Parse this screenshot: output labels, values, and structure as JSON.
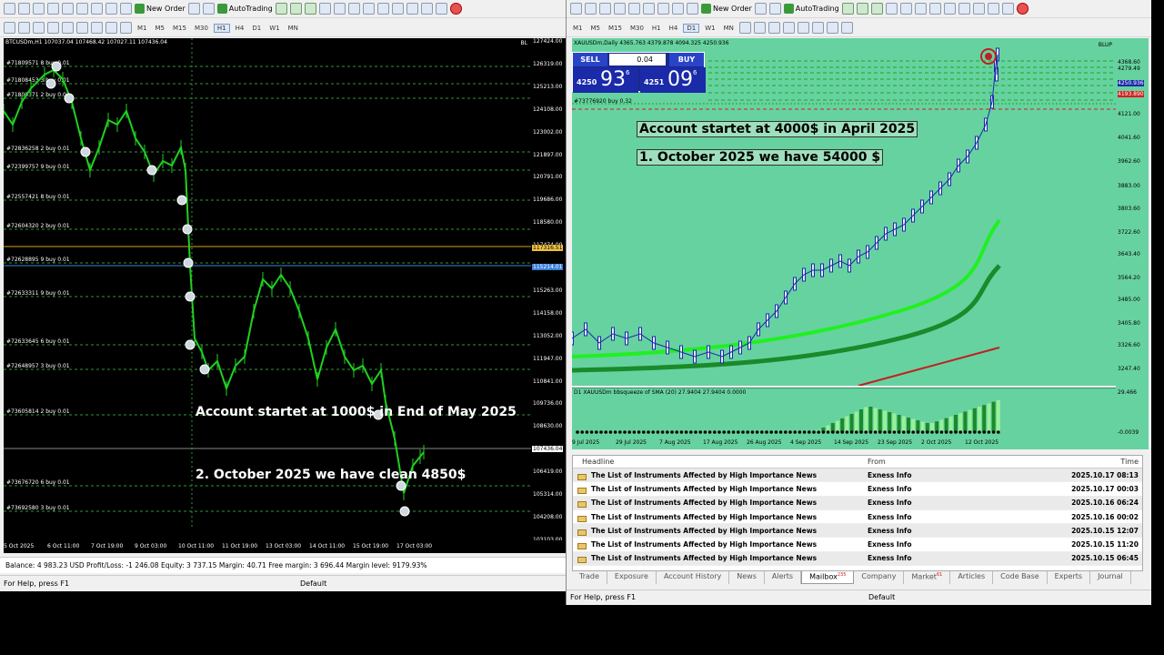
{
  "left": {
    "toolbar": {
      "new_order": "New Order",
      "autotrading": "AutoTrading",
      "timeframes": [
        "M1",
        "M5",
        "M15",
        "M30",
        "H1",
        "H4",
        "D1",
        "W1",
        "MN"
      ],
      "active_tf": "H1"
    },
    "chart_title": "BTCUSDm,H1  107037.04 107468.42 107027.11 107436.04",
    "corner_label": "BL",
    "price_labels": [
      "127424.00",
      "126319.00",
      "125213.00",
      "124108.00",
      "123002.00",
      "121897.00",
      "120791.00",
      "119686.00",
      "118580.00",
      "117474.00",
      "116369.00",
      "115263.00",
      "114158.00",
      "113052.00",
      "111947.00",
      "110841.00",
      "109736.00",
      "108630.00",
      "107525.00",
      "106419.00",
      "105314.00",
      "104208.00",
      "103103.00"
    ],
    "highlight_price_1": "117316.51",
    "highlight_price_2": "115214.01",
    "highlight_price_3": "107436.04",
    "order_labels": [
      "#71809571 8 buy 0.01",
      "#71808453 3 buy 0.01",
      "#71800371 2 buy 0.01",
      "#72836258 2 buy 0.01",
      "#72399757 9 buy 0.01",
      "#72557421 8 buy 0.01",
      "#72604320 2 buy 0.01",
      "#72628895 9 buy 0.01",
      "#72633311 9 buy 0.01",
      "#72633645 6 buy 0.01",
      "#72648957 3 buy 0.01",
      "#73605814 2 buy 0.01",
      "#73676720 6 buy 0.01",
      "#73692580 3 buy 0.01"
    ],
    "dates": [
      "5 Oct 2025",
      "6 Oct 11:00",
      "7 Oct 19:00",
      "9 Oct 03:00",
      "10 Oct 11:00",
      "11 Oct 19:00",
      "13 Oct 03:00",
      "14 Oct 11:00",
      "15 Oct 19:00",
      "17 Oct 03:00"
    ],
    "annotation_1": "Account startet at 1000$ in End of May 2025",
    "annotation_2": "2. October 2025 we have clean 4850$",
    "status": "Balance: 4 983.23 USD  Profit/Loss: -1 246.08  Equity: 3 737.15  Margin: 40.71  Free margin: 3 696.44  Margin level: 9179.93%",
    "help": "For Help, press F1",
    "profile": "Default"
  },
  "right": {
    "toolbar": {
      "new_order": "New Order",
      "autotrading": "AutoTrading",
      "timeframes": [
        "M1",
        "M5",
        "M15",
        "M30",
        "H1",
        "H4",
        "D1",
        "W1",
        "MN"
      ],
      "active_tf": "D1"
    },
    "chart_title": "XAUUSDm,Daily  4365.763 4379.878 4094.325 4250.936",
    "corner_label": "BLUP",
    "trade_panel": {
      "sell": "SELL",
      "buy": "BUY",
      "lot": "0.04",
      "sell_prefix": "4250",
      "sell_big": "93",
      "sell_sup": "6",
      "buy_prefix": "4251",
      "buy_big": "09",
      "buy_sup": "6"
    },
    "order_label": "#73776920 buy 0.32",
    "annotation_1": "Account startet at 4000$ in April 2025",
    "annotation_2": "1. October 2025 we have 54000 $",
    "price_labels": [
      "4368.60",
      "4279.49",
      "4250.936",
      "4193.890",
      "4121.00",
      "4041.60",
      "3962.60",
      "3883.00",
      "3803.60",
      "3722.60",
      "3643.40",
      "3564.20",
      "3485.00",
      "3405.80",
      "3326.60",
      "3247.40"
    ],
    "sub_label": "D1 XAUUSDm bbsqueeze of SMA (20) 27.9404 27.9404 0.0000",
    "sub_max": "29.466",
    "sub_min": "-0.0039",
    "dates": [
      "9 Jul 2025",
      "29 Jul 2025",
      "7 Aug 2025",
      "17 Aug 2025",
      "26 Aug 2025",
      "4 Sep 2025",
      "14 Sep 2025",
      "23 Sep 2025",
      "2 Oct 2025",
      "12 Oct 2025"
    ],
    "terminal": {
      "columns": [
        "Headline",
        "From",
        "Time"
      ],
      "rows": [
        {
          "headline": "The List of Instruments Affected by High Importance News",
          "from": "Exness Info",
          "time": "2025.10.17 08:13"
        },
        {
          "headline": "The List of Instruments Affected by High Importance News",
          "from": "Exness Info",
          "time": "2025.10.17 00:03"
        },
        {
          "headline": "The List of Instruments Affected by High Importance News",
          "from": "Exness Info",
          "time": "2025.10.16 06:24"
        },
        {
          "headline": "The List of Instruments Affected by High Importance News",
          "from": "Exness Info",
          "time": "2025.10.16 00:02"
        },
        {
          "headline": "The List of Instruments Affected by High Importance News",
          "from": "Exness Info",
          "time": "2025.10.15 12:07"
        },
        {
          "headline": "The List of Instruments Affected by High Importance News",
          "from": "Exness Info",
          "time": "2025.10.15 11:20"
        },
        {
          "headline": "The List of Instruments Affected by High Importance News",
          "from": "Exness Info",
          "time": "2025.10.15 06:45"
        }
      ],
      "tabs": [
        "Trade",
        "Exposure",
        "Account History",
        "News",
        "Alerts",
        "Mailbox",
        "Company",
        "Market",
        "Articles",
        "Code Base",
        "Experts",
        "Journal"
      ],
      "active_tab": "Mailbox",
      "mailbox_badge": "235",
      "market_badge": "61"
    },
    "help": "For Help, press F1",
    "profile": "Default"
  }
}
